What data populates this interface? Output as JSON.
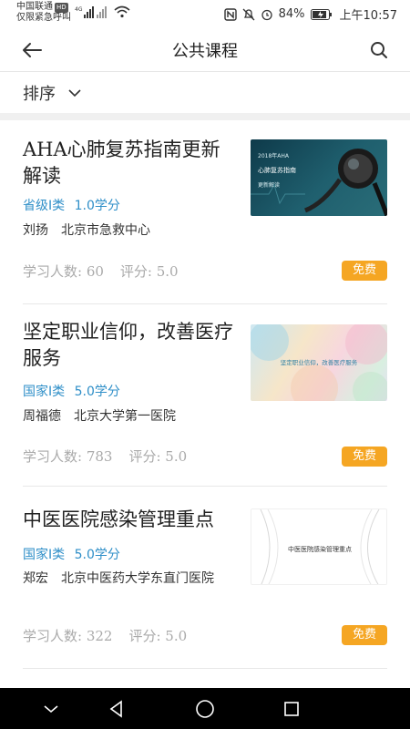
{
  "status_bar": {
    "carrier_line1": "中国联通",
    "hd_badge": "HD",
    "carrier_line2": "仅限紧急呼叫",
    "network": "4G",
    "battery_percent": "84%",
    "time": "上午10:57"
  },
  "header": {
    "title": "公共课程"
  },
  "sort": {
    "label": "排序"
  },
  "courses": [
    {
      "title": "AHA心肺复苏指南更新解读",
      "level": "省级I类",
      "credits": "1.0学分",
      "author": "刘扬",
      "institution": "北京市急救中心",
      "learners": "学习人数: 60",
      "rating": "评分: 5.0",
      "badge": "免费",
      "thumb_text": "2018年AHA\n心肺复苏指南\n更新解读"
    },
    {
      "title": "坚定职业信仰，改善医疗服务",
      "level": "国家I类",
      "credits": "5.0学分",
      "author": "周福德",
      "institution": "北京大学第一医院",
      "learners": "学习人数: 783",
      "rating": "评分: 5.0",
      "badge": "免费",
      "thumb_text": "坚定职业信仰，改善医疗服务"
    },
    {
      "title": "中医医院感染管理重点",
      "level": "国家I类",
      "credits": "5.0学分",
      "author": "郑宏",
      "institution": "北京中医药大学东直门医院",
      "learners": "学习人数: 322",
      "rating": "评分: 5.0",
      "badge": "免费",
      "thumb_text": "中医医院感染管理重点"
    }
  ],
  "colors": {
    "accent_blue": "#2f8fc8",
    "badge_orange": "#f5a623",
    "muted_gray": "#aaaaaa"
  }
}
